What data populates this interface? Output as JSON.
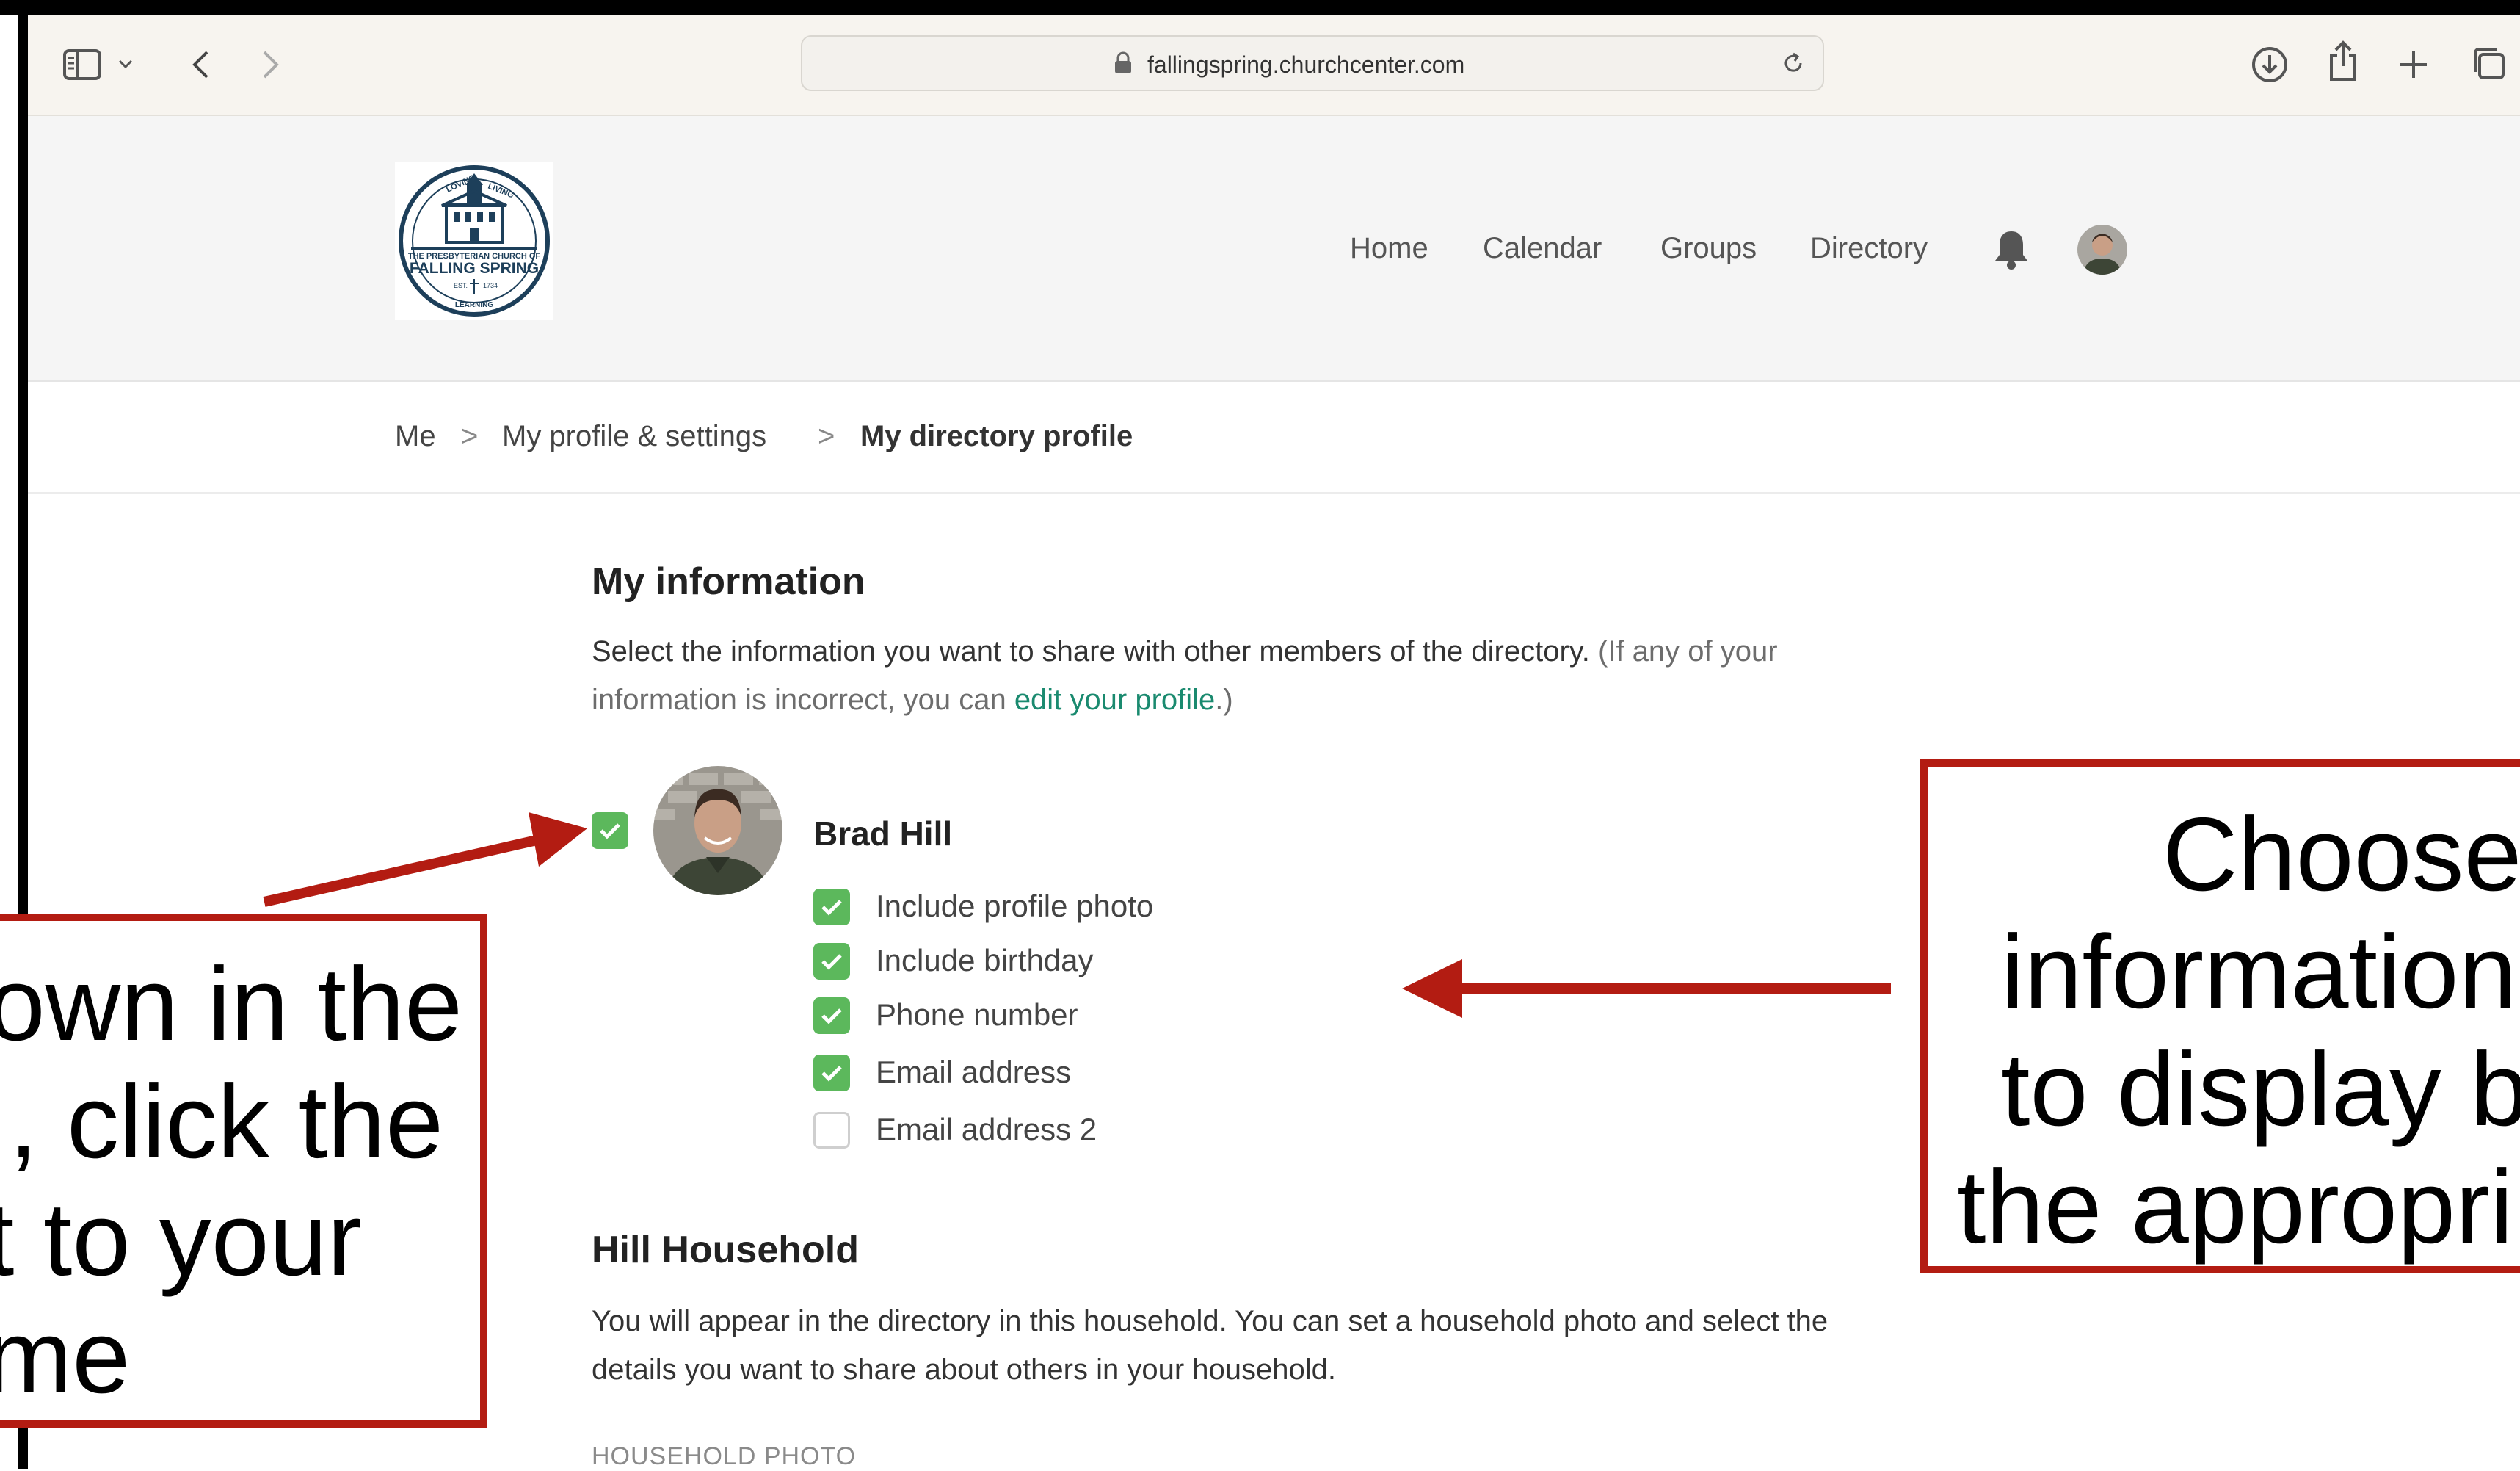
{
  "browser": {
    "url": "fallingspring.churchcenter.com"
  },
  "site": {
    "logo_lines": [
      "LOVING",
      "LIVING",
      "THE PRESBYTERIAN CHURCH OF",
      "FALLING SPRING",
      "EST.",
      "1734",
      "LEARNING"
    ],
    "nav": [
      "Home",
      "Calendar",
      "Groups",
      "Directory"
    ]
  },
  "breadcrumb": {
    "items": [
      "Me",
      "My profile & settings",
      "My directory profile"
    ],
    "separator": ">"
  },
  "my_information": {
    "heading": "My information",
    "desc_main": "Select the information you want to share with other members of the directory.",
    "desc_muted_1": " (If any of your",
    "desc_muted_2": "information is incorrect, you can ",
    "desc_link": "edit your profile",
    "desc_end": ".)",
    "person_name": "Brad Hill",
    "options": [
      {
        "label": "Include profile photo",
        "checked": true
      },
      {
        "label": "Include birthday",
        "checked": true
      },
      {
        "label": "Phone number",
        "checked": true
      },
      {
        "label": "Email address",
        "checked": true
      },
      {
        "label": "Email address 2",
        "checked": false
      }
    ]
  },
  "household": {
    "heading": "Hill Household",
    "desc_line1": "You will appear in the directory in this household. You can set a household photo and select the",
    "desc_line2": "details you want to share about others in your household.",
    "photo_label": "HOUSEHOLD PHOTO"
  },
  "callouts": {
    "left_lines": [
      "own in the",
      ", click the",
      "t to your",
      "me"
    ],
    "right_lines": [
      "Choose",
      "information",
      "to display b",
      "the appropri"
    ]
  },
  "colors": {
    "accent_green": "#5cb85c",
    "link_teal": "#1a8a6f",
    "callout_red": "#b31c12",
    "logo_navy": "#1d3f5a"
  }
}
